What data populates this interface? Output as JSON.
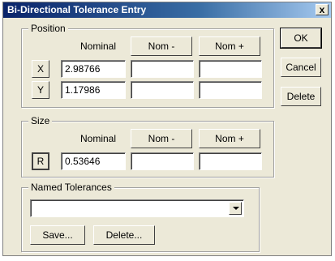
{
  "window": {
    "title": "Bi-Directional Tolerance Entry",
    "close_glyph": "x"
  },
  "position": {
    "label": "Position",
    "nominal_label": "Nominal",
    "nom_minus_label": "Nom -",
    "nom_plus_label": "Nom +",
    "rows": [
      {
        "axis": "X",
        "nominal": "2.98766",
        "nom_minus": "",
        "nom_plus": ""
      },
      {
        "axis": "Y",
        "nominal": "1.17986",
        "nom_minus": "",
        "nom_plus": ""
      }
    ]
  },
  "size": {
    "label": "Size",
    "nominal_label": "Nominal",
    "nom_minus_label": "Nom -",
    "nom_plus_label": "Nom +",
    "rows": [
      {
        "axis": "R",
        "nominal": "0.53646",
        "nom_minus": "",
        "nom_plus": ""
      }
    ]
  },
  "named_tolerances": {
    "label": "Named Tolerances",
    "selected": "",
    "save_label": "Save...",
    "delete_label": "Delete..."
  },
  "buttons": {
    "ok": "OK",
    "cancel": "Cancel",
    "delete": "Delete"
  }
}
